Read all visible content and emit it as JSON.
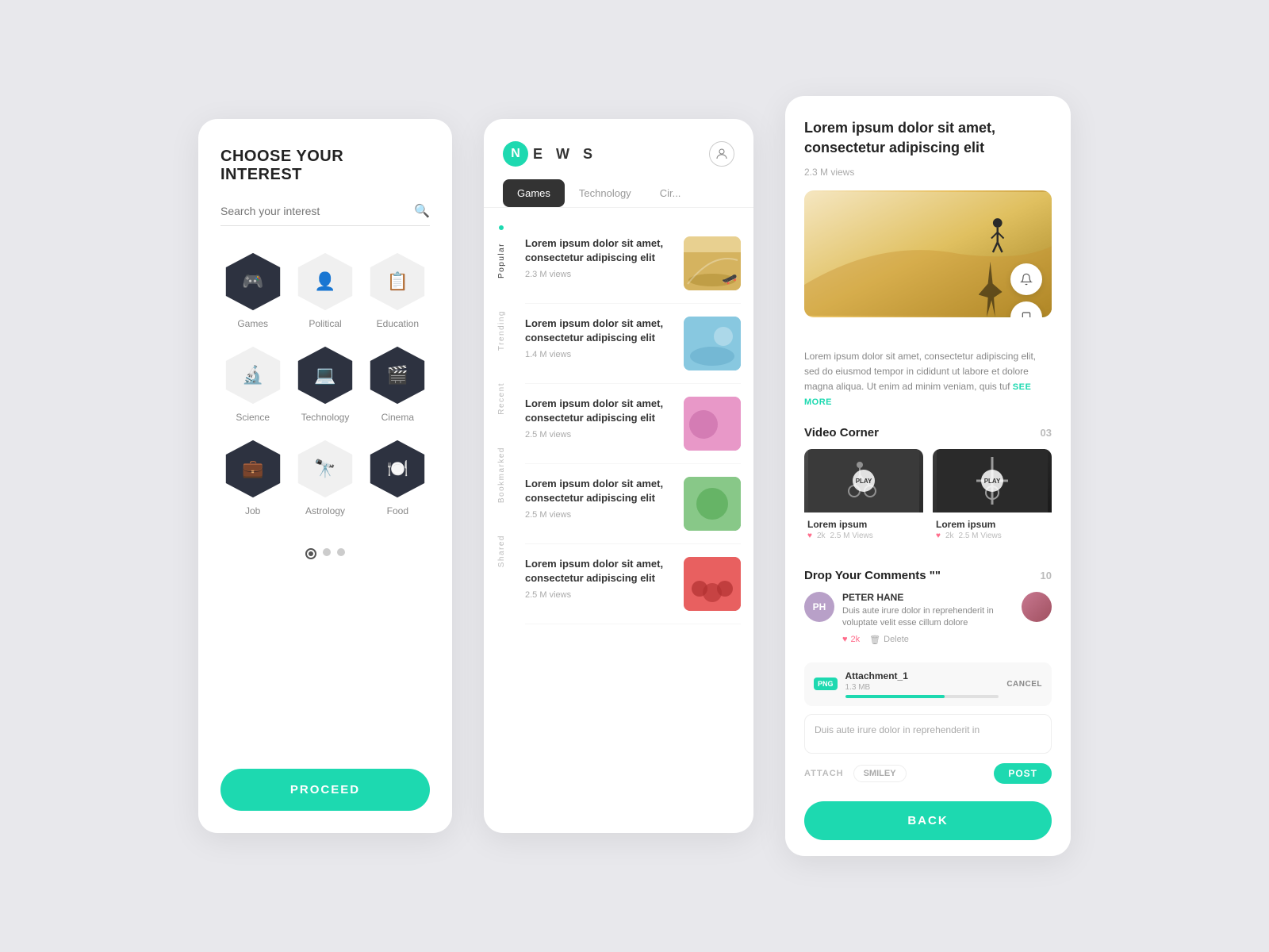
{
  "panel1": {
    "title": "CHOOSE YOUR INTEREST",
    "search_placeholder": "Search your interest",
    "proceed_label": "PROCEED",
    "interests": [
      {
        "id": "games",
        "label": "Games",
        "dark": true,
        "icon": "🎮"
      },
      {
        "id": "political",
        "label": "Political",
        "dark": false,
        "icon": "👤"
      },
      {
        "id": "education",
        "label": "Education",
        "dark": false,
        "icon": "📋"
      },
      {
        "id": "science",
        "label": "Science",
        "dark": false,
        "icon": "🔬"
      },
      {
        "id": "technology",
        "label": "Technology",
        "dark": true,
        "icon": "💻"
      },
      {
        "id": "cinema",
        "label": "Cinema",
        "dark": true,
        "icon": "🎬"
      },
      {
        "id": "job",
        "label": "Job",
        "dark": true,
        "icon": "💼"
      },
      {
        "id": "astrology",
        "label": "Astrology",
        "dark": false,
        "icon": "🔭"
      },
      {
        "id": "food",
        "label": "Food",
        "dark": true,
        "icon": "🍽️"
      }
    ]
  },
  "panel2": {
    "logo_letter": "N",
    "logo_text": "E W S",
    "tabs": [
      "Games",
      "Technology",
      "Cir..."
    ],
    "active_tab": "Games",
    "sidebar_items": [
      "Popular",
      "Trending",
      "Recent",
      "Bookmarked",
      "Shared"
    ],
    "active_sidebar": "Popular",
    "articles": [
      {
        "title": "Lorem ipsum dolor sit amet, consectetur adipiscing elit",
        "views": "2.3 M views",
        "img_class": "img-1"
      },
      {
        "title": "Lorem ipsum dolor sit amet, consectetur adipiscing elit",
        "views": "1.4 M views",
        "img_class": "img-2"
      },
      {
        "title": "Lorem ipsum dolor sit amet, consectetur adipiscing elit",
        "views": "2.5 M views",
        "img_class": "img-3"
      },
      {
        "title": "Lorem ipsum dolor sit amet, consectetur adipiscing elit",
        "views": "2.5 M views",
        "img_class": "img-4"
      },
      {
        "title": "Lorem ipsum dolor sit amet, consectetur adipiscing elit",
        "views": "2.5 M views",
        "img_class": "img-5"
      }
    ]
  },
  "panel3": {
    "article_title": "Lorem ipsum dolor sit amet, consectetur adipiscing elit",
    "article_views": "2.3 M views",
    "article_body": "Lorem ipsum dolor sit amet, consectetur adipiscing elit, sed do eiusmod tempor in cididunt ut labore et dolore magna aliqua. Ut enim ad minim veniam, quis tuf",
    "see_more_label": "SEE MORE",
    "video_corner_title": "Video Corner",
    "video_count": "03",
    "videos": [
      {
        "name": "Lorem ipsum",
        "likes": "2k",
        "views": "2.5 M Views"
      },
      {
        "name": "Lorem ipsum",
        "likes": "2k",
        "views": "2.5 M Views"
      }
    ],
    "comments_title": "Drop Your Comments \"\"",
    "comments_count": "10",
    "comments": [
      {
        "initials": "PH",
        "name": "PETER HANE",
        "text": "Duis aute irure dolor in reprehenderit in voluptate velit esse cillum dolore",
        "likes": "2k",
        "avatar_type": "initials",
        "bg": "#b8a0c8"
      }
    ],
    "attachment": {
      "name": "Attachment_1",
      "badge": "PNG",
      "size": "1.3 MB",
      "progress": 65,
      "cancel_label": "CANCEL"
    },
    "comment_placeholder": "Duis aute irure dolor in reprehenderit in",
    "toolbar": {
      "attach_label": "ATTACH",
      "smiley_label": "SMILEY",
      "post_label": "POST"
    },
    "back_label": "BACK"
  }
}
